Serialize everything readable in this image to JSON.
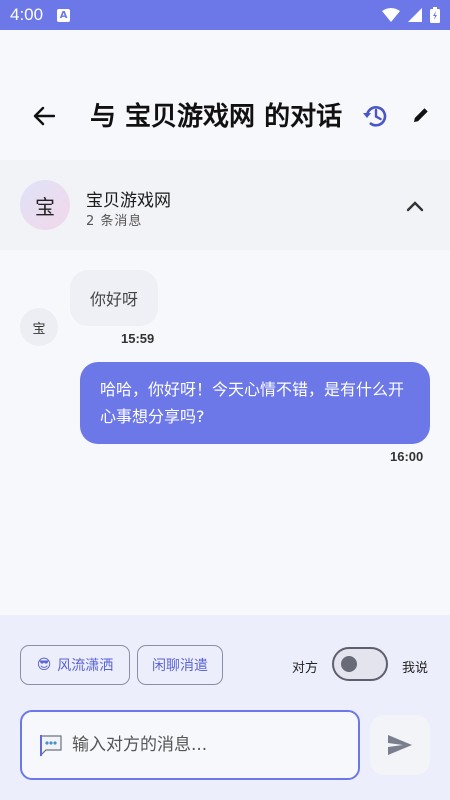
{
  "status_bar": {
    "time": "4:00",
    "notification_badge": "A"
  },
  "header": {
    "title": "与 宝贝游戏网 的对话"
  },
  "contact": {
    "avatar_char": "宝",
    "name": "宝贝游戏网",
    "message_count": "2 条消息"
  },
  "messages": [
    {
      "direction": "incoming",
      "avatar_char": "宝",
      "text": "你好呀",
      "time": "15:59"
    },
    {
      "direction": "outgoing",
      "text": "哈哈，你好呀！今天心情不错，是有什么开心事想分享吗?",
      "time": "16:00"
    }
  ],
  "style_chips": [
    {
      "emoji": "😎",
      "label": "风流潇洒"
    },
    {
      "emoji": "",
      "label": "闲聊消遣"
    }
  ],
  "speaker_toggle": {
    "left_label": "对方",
    "right_label": "我说",
    "state": "left"
  },
  "composer": {
    "placeholder": "输入对方的消息...",
    "value": ""
  },
  "colors": {
    "accent": "#6c78e8",
    "background": "#f7f8fc",
    "bottom_panel": "#eceefb"
  }
}
